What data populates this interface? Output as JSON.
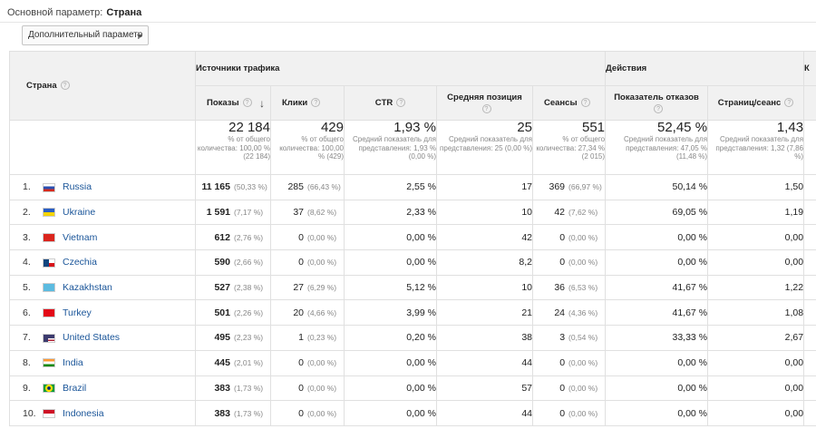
{
  "primary_dimension": {
    "label": "Основной параметр:",
    "value": "Страна"
  },
  "secondary_dimension": {
    "label": "Дополнительный параметр"
  },
  "table": {
    "dimension_header": "Страна",
    "groups": [
      {
        "label": "Источники трафика"
      },
      {
        "label": "Действия"
      },
      {
        "label": "К"
      }
    ],
    "columns": [
      {
        "label": "Показы"
      },
      {
        "label": "Клики"
      },
      {
        "label": "CTR"
      },
      {
        "label": "Средняя позиция"
      },
      {
        "label": "Сеансы"
      },
      {
        "label": "Показатель отказов"
      },
      {
        "label": "Страниц/сеанс"
      }
    ],
    "totals": [
      {
        "value": "22 184",
        "sub": "% от общего количества: 100,00 % (22 184)"
      },
      {
        "value": "429",
        "sub": "% от общего количества: 100,00 % (429)"
      },
      {
        "value": "1,93 %",
        "sub": "Средний показатель для представления: 1,93 % (0,00 %)"
      },
      {
        "value": "25",
        "sub": "Средний показатель для представления: 25 (0,00 %)"
      },
      {
        "value": "551",
        "sub": "% от общего количества: 27,34 % (2 015)"
      },
      {
        "value": "52,45 %",
        "sub": "Средний показатель для представления: 47,05 % (11,48 %)"
      },
      {
        "value": "1,43",
        "sub": "Средний показатель для представления: 1,32 (7,86 %)"
      }
    ],
    "rows": [
      {
        "rank": "1.",
        "country": "Russia",
        "impressions": "11 165",
        "impressions_pct": "(50,33 %)",
        "clicks": "285",
        "clicks_pct": "(66,43 %)",
        "ctr": "2,55 %",
        "position": "17",
        "sessions": "369",
        "sessions_pct": "(66,97 %)",
        "bounce": "50,14 %",
        "pages": "1,50"
      },
      {
        "rank": "2.",
        "country": "Ukraine",
        "impressions": "1 591",
        "impressions_pct": "(7,17 %)",
        "clicks": "37",
        "clicks_pct": "(8,62 %)",
        "ctr": "2,33 %",
        "position": "10",
        "sessions": "42",
        "sessions_pct": "(7,62 %)",
        "bounce": "69,05 %",
        "pages": "1,19"
      },
      {
        "rank": "3.",
        "country": "Vietnam",
        "impressions": "612",
        "impressions_pct": "(2,76 %)",
        "clicks": "0",
        "clicks_pct": "(0,00 %)",
        "ctr": "0,00 %",
        "position": "42",
        "sessions": "0",
        "sessions_pct": "(0,00 %)",
        "bounce": "0,00 %",
        "pages": "0,00"
      },
      {
        "rank": "4.",
        "country": "Czechia",
        "impressions": "590",
        "impressions_pct": "(2,66 %)",
        "clicks": "0",
        "clicks_pct": "(0,00 %)",
        "ctr": "0,00 %",
        "position": "8,2",
        "sessions": "0",
        "sessions_pct": "(0,00 %)",
        "bounce": "0,00 %",
        "pages": "0,00"
      },
      {
        "rank": "5.",
        "country": "Kazakhstan",
        "impressions": "527",
        "impressions_pct": "(2,38 %)",
        "clicks": "27",
        "clicks_pct": "(6,29 %)",
        "ctr": "5,12 %",
        "position": "10",
        "sessions": "36",
        "sessions_pct": "(6,53 %)",
        "bounce": "41,67 %",
        "pages": "1,22"
      },
      {
        "rank": "6.",
        "country": "Turkey",
        "impressions": "501",
        "impressions_pct": "(2,26 %)",
        "clicks": "20",
        "clicks_pct": "(4,66 %)",
        "ctr": "3,99 %",
        "position": "21",
        "sessions": "24",
        "sessions_pct": "(4,36 %)",
        "bounce": "41,67 %",
        "pages": "1,08"
      },
      {
        "rank": "7.",
        "country": "United States",
        "impressions": "495",
        "impressions_pct": "(2,23 %)",
        "clicks": "1",
        "clicks_pct": "(0,23 %)",
        "ctr": "0,20 %",
        "position": "38",
        "sessions": "3",
        "sessions_pct": "(0,54 %)",
        "bounce": "33,33 %",
        "pages": "2,67"
      },
      {
        "rank": "8.",
        "country": "India",
        "impressions": "445",
        "impressions_pct": "(2,01 %)",
        "clicks": "0",
        "clicks_pct": "(0,00 %)",
        "ctr": "0,00 %",
        "position": "44",
        "sessions": "0",
        "sessions_pct": "(0,00 %)",
        "bounce": "0,00 %",
        "pages": "0,00"
      },
      {
        "rank": "9.",
        "country": "Brazil",
        "impressions": "383",
        "impressions_pct": "(1,73 %)",
        "clicks": "0",
        "clicks_pct": "(0,00 %)",
        "ctr": "0,00 %",
        "position": "57",
        "sessions": "0",
        "sessions_pct": "(0,00 %)",
        "bounce": "0,00 %",
        "pages": "0,00"
      },
      {
        "rank": "10.",
        "country": "Indonesia",
        "impressions": "383",
        "impressions_pct": "(1,73 %)",
        "clicks": "0",
        "clicks_pct": "(0,00 %)",
        "ctr": "0,00 %",
        "position": "44",
        "sessions": "0",
        "sessions_pct": "(0,00 %)",
        "bounce": "0,00 %",
        "pages": "0,00"
      }
    ]
  },
  "flags": {
    "Russia": [
      "#ffffff",
      "#2a4fb0",
      "#d52b1e"
    ],
    "Ukraine": [
      "#2b5fc4",
      "#f5d400"
    ],
    "Vietnam": [
      "#da251d"
    ],
    "Czechia": [
      "#ffffff",
      "#d7141a",
      "#11457e"
    ],
    "Kazakhstan": [
      "#5cbbe0"
    ],
    "Turkey": [
      "#e30a17"
    ],
    "United States": [
      "#b22234",
      "#ffffff",
      "#3c3b6e"
    ],
    "India": [
      "#ff9933",
      "#ffffff",
      "#138808"
    ],
    "Brazil": [
      "#009c3b",
      "#ffdf00",
      "#002776"
    ],
    "Indonesia": [
      "#ce1126",
      "#ffffff"
    ]
  }
}
